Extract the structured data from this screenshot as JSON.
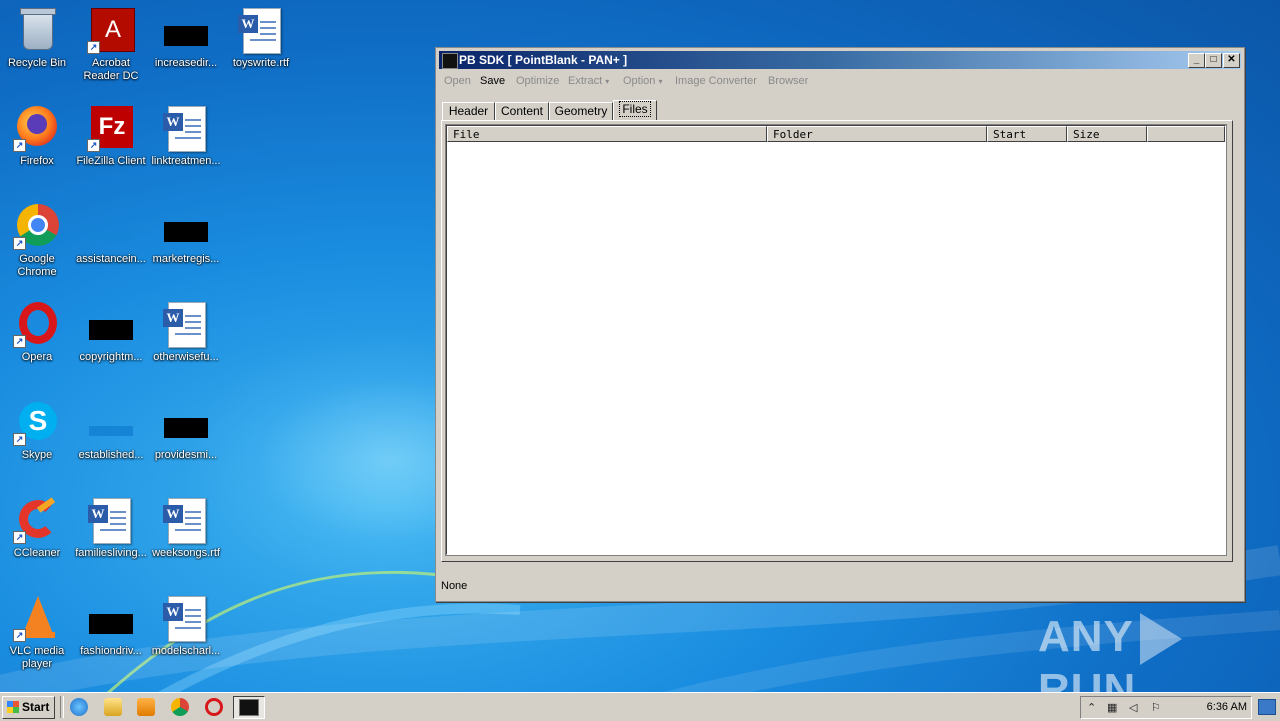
{
  "desktop": {
    "icons": [
      {
        "label": "Recycle Bin",
        "icon": "recycle-bin-icon"
      },
      {
        "label": "Acrobat Reader DC",
        "line1": "Acrobat",
        "line2": "Reader DC",
        "icon": "acrobat-icon"
      },
      {
        "label": "increasedir...",
        "icon": "blank-file-icon"
      },
      {
        "label": "toyswrite.rtf",
        "icon": "word-document-icon"
      },
      {
        "label": "Firefox",
        "icon": "firefox-icon"
      },
      {
        "label": "FileZilla Client",
        "icon": "filezilla-icon"
      },
      {
        "label": "linktreatmen...",
        "icon": "word-document-icon"
      },
      {
        "label": "Google Chrome",
        "line1": "Google",
        "line2": "Chrome",
        "icon": "chrome-icon"
      },
      {
        "label": "assistancein...",
        "icon": "blank-file-icon"
      },
      {
        "label": "marketregis...",
        "icon": "blank-file-icon"
      },
      {
        "label": "Opera",
        "icon": "opera-icon"
      },
      {
        "label": "copyrightm...",
        "icon": "blank-file-icon"
      },
      {
        "label": "otherwisefu...",
        "icon": "word-document-icon"
      },
      {
        "label": "Skype",
        "icon": "skype-icon"
      },
      {
        "label": "established...",
        "icon": "blank-file-icon"
      },
      {
        "label": "providesmi...",
        "icon": "blank-file-icon"
      },
      {
        "label": "CCleaner",
        "icon": "ccleaner-icon"
      },
      {
        "label": "familiesliving...",
        "icon": "word-document-icon"
      },
      {
        "label": "weeksongs.rtf",
        "icon": "word-document-icon"
      },
      {
        "label": "VLC media player",
        "line1": "VLC media",
        "line2": "player",
        "icon": "vlc-icon"
      },
      {
        "label": "fashiondriv...",
        "icon": "blank-file-icon"
      },
      {
        "label": "modelscharl...",
        "icon": "word-document-icon"
      }
    ]
  },
  "window": {
    "title": "PB SDK  [ PointBlank - PAN+ ]",
    "menu": [
      {
        "label": "Open",
        "enabled": false
      },
      {
        "label": "Save",
        "enabled": true
      },
      {
        "label": "Optimize",
        "enabled": false
      },
      {
        "label": "Extract",
        "enabled": false,
        "dropdown": true
      },
      {
        "label": "Option",
        "enabled": false,
        "dropdown": true
      },
      {
        "label": "Image Converter",
        "enabled": false
      },
      {
        "label": "Browser",
        "enabled": false
      }
    ],
    "tabs": [
      "Header",
      "Content",
      "Geometry",
      "Files"
    ],
    "selected_tab": "Files",
    "columns": [
      "File",
      "Folder",
      "Start",
      "Size"
    ],
    "rows": [],
    "status": "None"
  },
  "taskbar": {
    "start_label": "Start",
    "clock": "6:36 AM",
    "dropdown_arrow": "▾"
  },
  "watermark": {
    "left": "ANY",
    "right": "RUN"
  },
  "colors": {
    "title_active_start": "#0a246a",
    "title_active_end": "#a6caf0",
    "window_face": "#d4d0c8"
  }
}
